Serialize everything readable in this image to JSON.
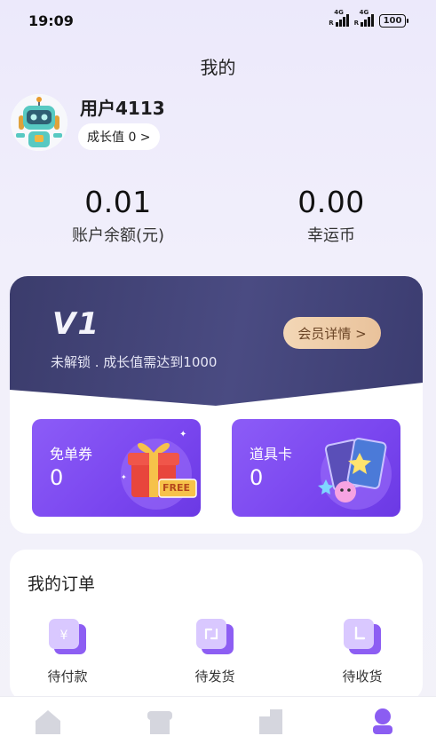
{
  "status_bar": {
    "time": "19:09",
    "battery": "100",
    "network": "4G"
  },
  "header": {
    "title": "我的"
  },
  "profile": {
    "username": "用户4113",
    "growth_label": "成长值 0 >"
  },
  "stats": {
    "balance": {
      "value": "0.01",
      "label": "账户余额(元)"
    },
    "lucky": {
      "value": "0.00",
      "label": "幸运币"
    }
  },
  "vip": {
    "level": "V1",
    "description": "未解锁 . 成长值需达到1000",
    "button_label": "会员详情 >",
    "coupons": [
      {
        "title": "免单券",
        "count": "0",
        "badge": "FREE"
      },
      {
        "title": "道具卡",
        "count": "0"
      }
    ]
  },
  "orders": {
    "title": "我的订单",
    "items": [
      {
        "label": "待付款",
        "icon": "payment-icon"
      },
      {
        "label": "待发货",
        "icon": "shipping-icon"
      },
      {
        "label": "待收货",
        "icon": "receiving-icon"
      }
    ]
  },
  "tabs": [
    {
      "icon": "home-icon"
    },
    {
      "icon": "store-icon"
    },
    {
      "icon": "buildings-icon"
    },
    {
      "icon": "profile-icon"
    }
  ],
  "colors": {
    "accent": "#7b4aef",
    "vip_bg": "#3f4175",
    "vip_button": "#efcfa9"
  }
}
